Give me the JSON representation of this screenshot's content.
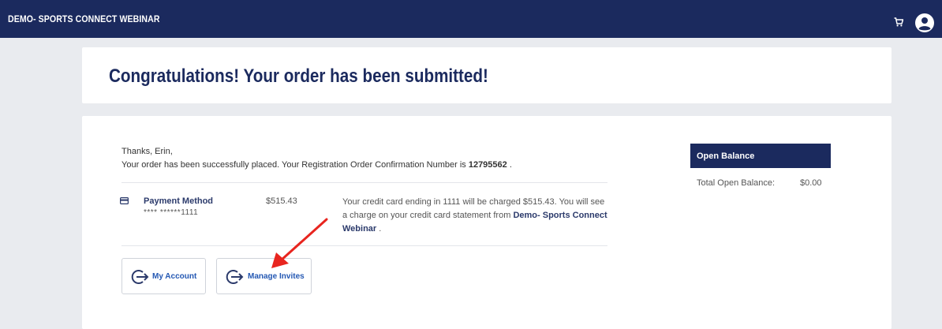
{
  "header": {
    "brand": "DEMO- SPORTS CONNECT WEBINAR",
    "background": "#1b2a5e"
  },
  "title_card": {
    "title": "Congratulations! Your order has been submitted!"
  },
  "order": {
    "greeting": "Thanks, Erin,",
    "placed_text": "Your order has been successfully placed. Your Registration Order Confirmation Number is",
    "confirmation_number": "12795562",
    "period": " ."
  },
  "payment": {
    "label": "Payment Method",
    "card_masked": "**** ******1111",
    "amount": "$515.43",
    "desc_start": "Your credit card ending in 1111 will be charged $515.43. You will see a charge on your credit card statement from",
    "merchant": "Demo- Sports Connect Webinar",
    "desc_end": " ."
  },
  "buttons": {
    "my_account": "My Account",
    "manage_invites": "Manage Invites"
  },
  "balance": {
    "header": "Open Balance",
    "label": "Total Open Balance:",
    "value": "$0.00"
  },
  "colors": {
    "primary": "#1b2a5e",
    "link": "#2458b3",
    "annotation_arrow": "#e8251f"
  },
  "icons": {
    "cart": "cart-icon",
    "user": "user-circle-icon",
    "payment": "credit-card-icon",
    "navigate": "circle-arrow-right-icon"
  }
}
